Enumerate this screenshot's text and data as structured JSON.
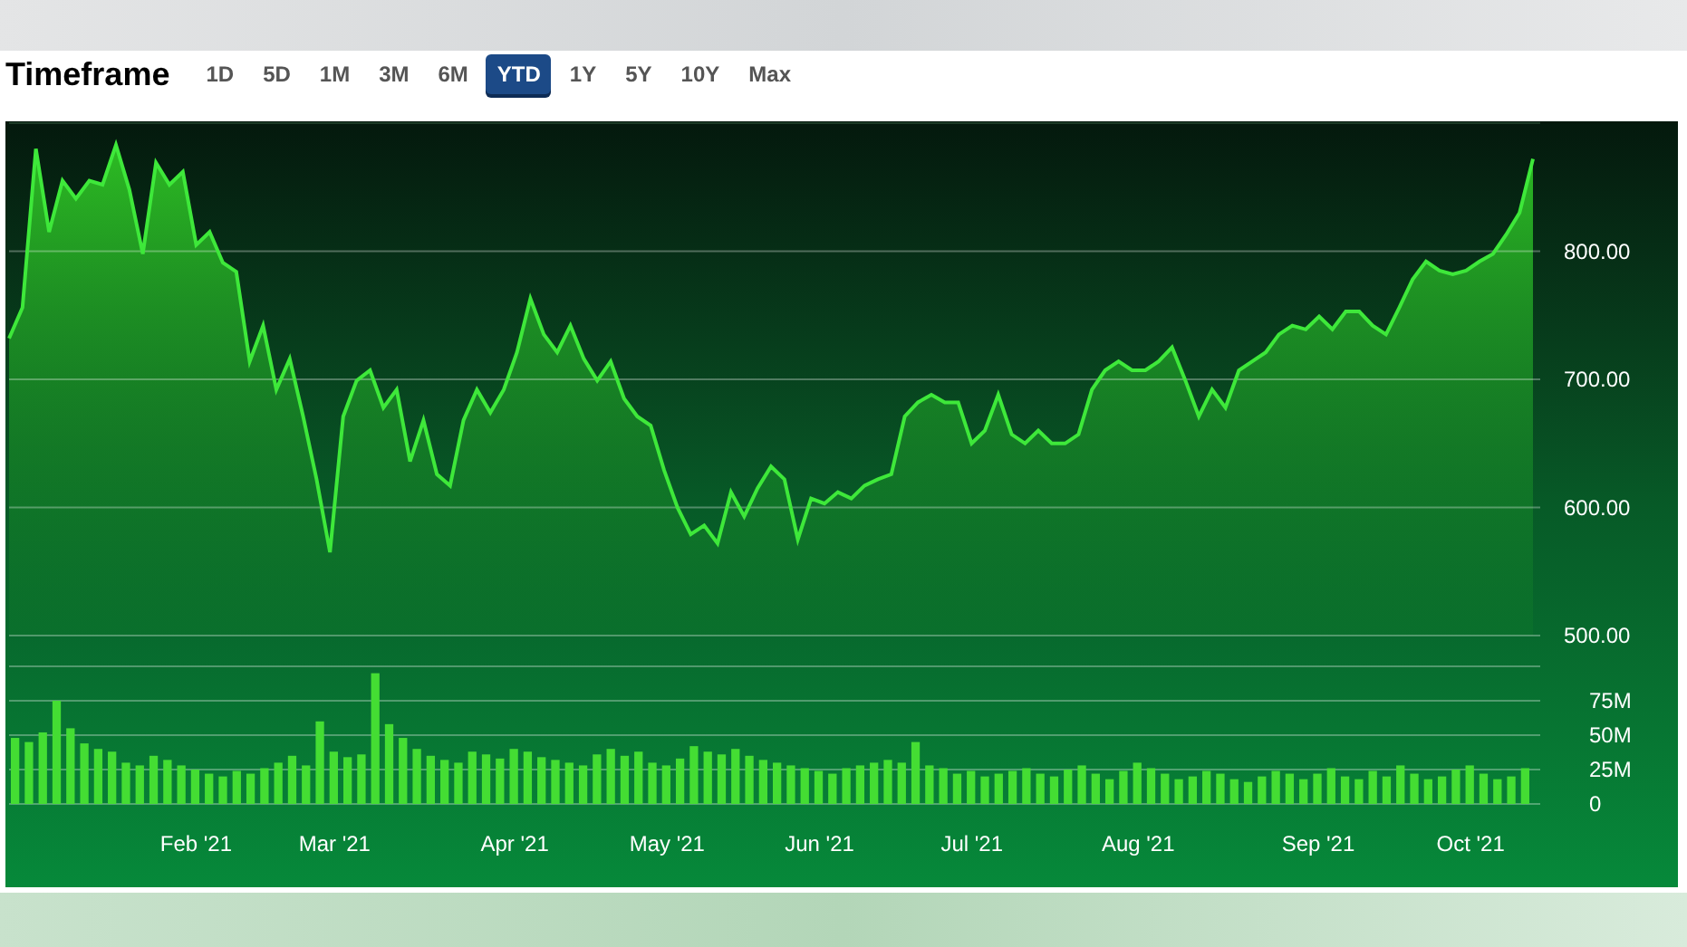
{
  "header": {
    "title": "Timeframe"
  },
  "timeframes": [
    {
      "label": "1D",
      "selected": false
    },
    {
      "label": "5D",
      "selected": false
    },
    {
      "label": "1M",
      "selected": false
    },
    {
      "label": "3M",
      "selected": false
    },
    {
      "label": "6M",
      "selected": false
    },
    {
      "label": "YTD",
      "selected": true
    },
    {
      "label": "1Y",
      "selected": false
    },
    {
      "label": "5Y",
      "selected": false
    },
    {
      "label": "10Y",
      "selected": false
    },
    {
      "label": "Max",
      "selected": false
    }
  ],
  "price_chart": {
    "chart_data": {
      "type": "area",
      "grid": true,
      "ylim": [
        500,
        900
      ],
      "yticks": [
        {
          "value": 500,
          "label": "500.00"
        },
        {
          "value": 600,
          "label": "600.00"
        },
        {
          "value": 700,
          "label": "700.00"
        },
        {
          "value": 800,
          "label": "800.00"
        }
      ],
      "series": [
        {
          "color": "#3ee83a",
          "values": [
            732,
            756,
            880,
            815,
            855,
            841,
            855,
            852,
            883,
            848,
            798,
            869,
            852,
            862,
            805,
            815,
            791,
            784,
            714,
            742,
            692,
            716,
            671,
            622,
            565,
            671,
            699,
            707,
            678,
            692,
            636,
            668,
            626,
            617,
            668,
            692,
            674,
            692,
            721,
            763,
            735,
            721,
            742,
            716,
            699,
            714,
            685,
            671,
            664,
            629,
            600,
            579,
            586,
            572,
            612,
            593,
            615,
            632,
            622,
            575,
            607,
            603,
            612,
            607,
            617,
            622,
            626,
            671,
            682,
            688,
            682,
            682,
            650,
            660,
            688,
            657,
            650,
            660,
            650,
            650,
            657,
            692,
            707,
            714,
            707,
            707,
            714,
            725,
            699,
            671,
            692,
            678,
            707,
            714,
            721,
            735,
            742,
            739,
            749,
            739,
            753,
            753,
            742,
            735,
            756,
            778,
            792,
            785,
            782,
            785,
            792,
            798,
            813,
            830,
            872
          ]
        }
      ]
    }
  },
  "volume_chart": {
    "chart_data": {
      "type": "bar",
      "grid": true,
      "ylim": [
        0,
        100
      ],
      "yticks": [
        {
          "value": 0,
          "label": "0"
        },
        {
          "value": 25,
          "label": "25M"
        },
        {
          "value": 50,
          "label": "50M"
        },
        {
          "value": 75,
          "label": "75M"
        }
      ],
      "series": [
        {
          "color": "#44dd33",
          "values": [
            48,
            45,
            52,
            75,
            55,
            44,
            40,
            38,
            30,
            28,
            35,
            32,
            28,
            25,
            22,
            20,
            24,
            22,
            26,
            30,
            35,
            28,
            60,
            38,
            34,
            36,
            95,
            58,
            48,
            40,
            35,
            32,
            30,
            38,
            36,
            33,
            40,
            38,
            34,
            32,
            30,
            28,
            36,
            40,
            35,
            38,
            30,
            28,
            33,
            42,
            38,
            36,
            40,
            35,
            32,
            30,
            28,
            26,
            24,
            22,
            26,
            28,
            30,
            32,
            30,
            45,
            28,
            26,
            22,
            24,
            20,
            22,
            24,
            26,
            22,
            20,
            25,
            28,
            22,
            18,
            24,
            30,
            26,
            22,
            18,
            20,
            24,
            22,
            18,
            16,
            20,
            24,
            22,
            18,
            22,
            26,
            20,
            18,
            24,
            20,
            28,
            22,
            18,
            20,
            25,
            28,
            22,
            18,
            20,
            26
          ]
        }
      ]
    }
  },
  "x_axis_labels": [
    "Feb '21",
    "Mar '21",
    "Apr '21",
    "May '21",
    "Jun '21",
    "Jul '21",
    "Aug '21",
    "Sep '21",
    "Oct '21"
  ]
}
